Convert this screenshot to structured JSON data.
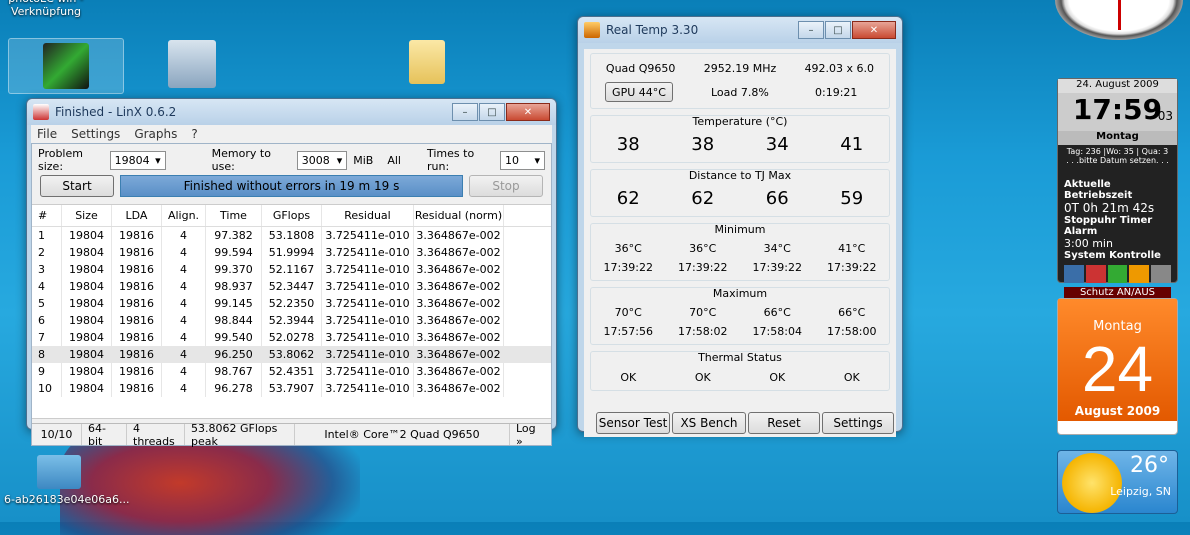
{
  "desktop": {
    "icons": [
      {
        "label": "photoLC win -\nVerknüpfung"
      },
      {
        "label": "6-ab26183e04e06a6..."
      }
    ]
  },
  "linx": {
    "title": "Finished - LinX 0.6.2",
    "menu": [
      "File",
      "Settings",
      "Graphs",
      "?"
    ],
    "problem_size_label": "Problem size:",
    "problem_size_value": "19804",
    "memory_label": "Memory to use:",
    "memory_value": "3008",
    "memory_unit": "MiB",
    "memory_all": "All",
    "times_label": "Times to run:",
    "times_value": "10",
    "start_label": "Start",
    "progress_text": "Finished without errors in 19 m 19 s",
    "stop_label": "Stop",
    "columns": [
      "#",
      "Size",
      "LDA",
      "Align.",
      "Time",
      "GFlops",
      "Residual",
      "Residual (norm)"
    ],
    "rows": [
      [
        "1",
        "19804",
        "19816",
        "4",
        "97.382",
        "53.1808",
        "3.725411e-010",
        "3.364867e-002"
      ],
      [
        "2",
        "19804",
        "19816",
        "4",
        "99.594",
        "51.9994",
        "3.725411e-010",
        "3.364867e-002"
      ],
      [
        "3",
        "19804",
        "19816",
        "4",
        "99.370",
        "52.1167",
        "3.725411e-010",
        "3.364867e-002"
      ],
      [
        "4",
        "19804",
        "19816",
        "4",
        "98.937",
        "52.3447",
        "3.725411e-010",
        "3.364867e-002"
      ],
      [
        "5",
        "19804",
        "19816",
        "4",
        "99.145",
        "52.2350",
        "3.725411e-010",
        "3.364867e-002"
      ],
      [
        "6",
        "19804",
        "19816",
        "4",
        "98.844",
        "52.3944",
        "3.725411e-010",
        "3.364867e-002"
      ],
      [
        "7",
        "19804",
        "19816",
        "4",
        "99.540",
        "52.0278",
        "3.725411e-010",
        "3.364867e-002"
      ],
      [
        "8",
        "19804",
        "19816",
        "4",
        "96.250",
        "53.8062",
        "3.725411e-010",
        "3.364867e-002"
      ],
      [
        "9",
        "19804",
        "19816",
        "4",
        "98.767",
        "52.4351",
        "3.725411e-010",
        "3.364867e-002"
      ],
      [
        "10",
        "19804",
        "19816",
        "4",
        "96.278",
        "53.7907",
        "3.725411e-010",
        "3.364867e-002"
      ]
    ],
    "status": [
      "10/10",
      "64-bit",
      "4 threads",
      "53.8062 GFlops peak",
      "Intel® Core™2 Quad Q9650",
      "Log »"
    ]
  },
  "realtemp": {
    "title": "Real Temp 3.30",
    "cpu": "Quad Q9650",
    "mhz": "2952.19 MHz",
    "multi": "492.03 x 6.0",
    "gpu_btn": "GPU  44°C",
    "load": "Load   7.8%",
    "time": "0:19:21",
    "temp_title": "Temperature (°C)",
    "temps": [
      "38",
      "38",
      "34",
      "41"
    ],
    "dist_title": "Distance to TJ Max",
    "dist": [
      "62",
      "62",
      "66",
      "59"
    ],
    "min_title": "Minimum",
    "min_temps": [
      "36°C",
      "36°C",
      "34°C",
      "41°C"
    ],
    "min_times": [
      "17:39:22",
      "17:39:22",
      "17:39:22",
      "17:39:22"
    ],
    "max_title": "Maximum",
    "max_temps": [
      "70°C",
      "70°C",
      "66°C",
      "66°C"
    ],
    "max_times": [
      "17:57:56",
      "17:58:02",
      "17:58:04",
      "17:58:00"
    ],
    "thermal_title": "Thermal Status",
    "thermal": [
      "OK",
      "OK",
      "OK",
      "OK"
    ],
    "buttons": [
      "Sensor Test",
      "XS Bench",
      "Reset",
      "Settings"
    ]
  },
  "gadget_sys": {
    "date": "24. August 2009",
    "time": "17:59",
    "sec": "03",
    "day": "Montag",
    "info": "Tag: 236 |Wo: 35 | Qua: 3",
    "info2": ". . .bitte Datum setzen. . .",
    "uptime_label": "Aktuelle Betriebszeit",
    "uptime": "0T 0h 21m 42s",
    "stopwatch": "Stoppuhr Timer Alarm",
    "timer": "3:00 min",
    "control": "System Kontrolle",
    "protect": "Schutz AN/AUS"
  },
  "gadget_cal": {
    "day": "Montag",
    "date": "24",
    "month": "August 2009"
  },
  "gadget_weather": {
    "temp": "26°",
    "city": "Leipzig, SN"
  },
  "colors": {
    "accent": "#e35900",
    "progress": "#6b9fd2"
  }
}
